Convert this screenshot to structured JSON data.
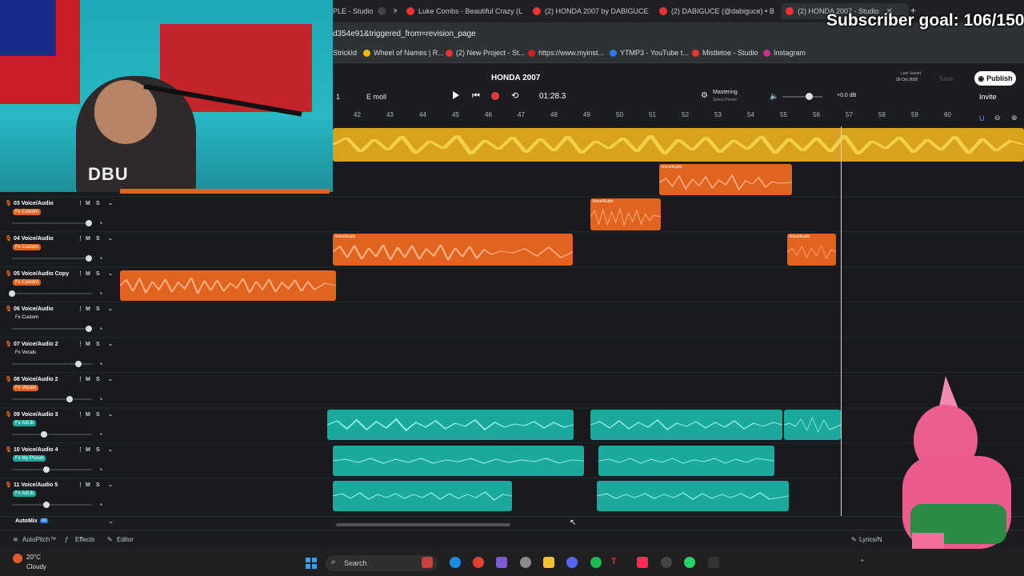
{
  "browser": {
    "tabs": [
      {
        "label": "PLE - Studio"
      },
      {
        "label": "Luke Combs - Beautiful Crazy (L"
      },
      {
        "label": "(2) HONDA 2007 by DABIGUCE"
      },
      {
        "label": "(2) DABIGUCE (@dabiguce) • B"
      },
      {
        "label": "(2) HONDA 2007 - Studio"
      }
    ],
    "url": "d354e91&triggered_from=revision_page",
    "bookmarks": [
      {
        "label": "StrickId"
      },
      {
        "label": "Wheel of Names | R..."
      },
      {
        "label": "(2) New Project - St..."
      },
      {
        "label": "https://www.myinst..."
      },
      {
        "label": "YTMP3 - YouTube t..."
      },
      {
        "label": "Mistletoe - Studio"
      },
      {
        "label": "Instagram"
      }
    ]
  },
  "overlay": {
    "subscriber_goal": "Subscriber goal: 106/150",
    "shirt_text": "DBU"
  },
  "daw": {
    "project_title": "HONDA 2007",
    "bar_counter": "1",
    "key": "E moll",
    "time": "01:28.3",
    "mastering_label": "Mastering",
    "mastering_preset": "Select Preset",
    "volume_db": "+0.0 dB",
    "last_saved_label": "Last Saved",
    "last_saved_date": "20 Oct 2025",
    "save_label": "Save",
    "publish_label": "Publish",
    "invite_label": "Invite",
    "ruler_ticks": [
      "42",
      "43",
      "44",
      "45",
      "46",
      "47",
      "48",
      "49",
      "50",
      "51",
      "52",
      "53",
      "54",
      "55",
      "56",
      "57",
      "58",
      "59",
      "60"
    ],
    "tracks": [
      {
        "name": "03 Voice/Audio",
        "fx": "Fx Custom",
        "fx_color": "#e0641f"
      },
      {
        "name": "04 Voice/Audio",
        "fx": "Fx Custom",
        "fx_color": "#e0641f"
      },
      {
        "name": "05 Voice/Audio Copy",
        "fx": "Fx Custom",
        "fx_color": "#e0641f"
      },
      {
        "name": "06 Voice/Audio",
        "fx": "Fx Custom",
        "fx_color": "transparent"
      },
      {
        "name": "07 Voice/Audio 2",
        "fx": "Fx Vocals",
        "fx_color": "transparent"
      },
      {
        "name": "08 Voice/Audio 2",
        "fx": "Fx Vocals",
        "fx_color": "#e0641f"
      },
      {
        "name": "09 Voice/Audio 3",
        "fx": "Fx AdLib",
        "fx_color": "#1ba99e"
      },
      {
        "name": "10 Voice/Audio 4",
        "fx": "Fx My Preset",
        "fx_color": "#1ba99e"
      },
      {
        "name": "11 Voice/Audio 5",
        "fx": "Fx AdLib",
        "fx_color": "#1ba99e"
      }
    ],
    "clip_label": "Voice/Audio",
    "mute_label": "M",
    "solo_label": "S",
    "automix_label": "AutoMix",
    "automix_badge": "AI",
    "bottom": {
      "autopitch": "AutoPitch™",
      "effects": "Effects",
      "editor": "Editor",
      "lyrics": "Lyrics/N"
    }
  },
  "taskbar": {
    "temperature": "20°C",
    "weather": "Cloudy",
    "search_placeholder": "Search"
  },
  "colors": {
    "orange_clip": "#e0641f",
    "teal_clip": "#1ba99e",
    "yellow_clip": "#d9a21c",
    "record": "#e23b3b"
  }
}
